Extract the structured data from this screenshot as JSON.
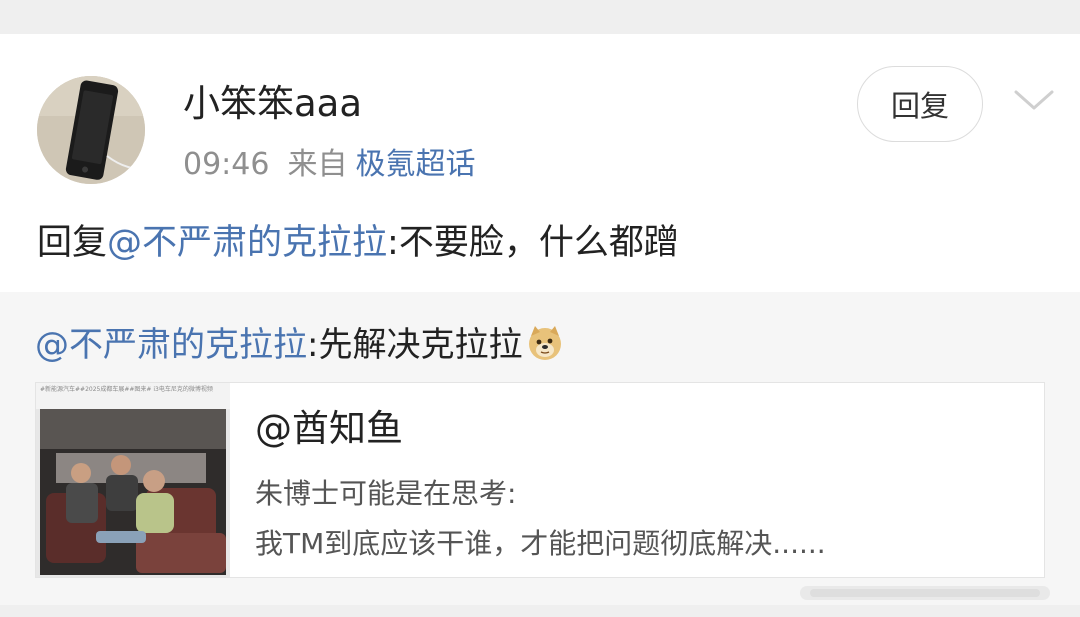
{
  "post": {
    "username": "小笨笨aaa",
    "time": "09:46",
    "source_prefix": "来自",
    "source_topic": "极氪超话",
    "reply_button": "回复",
    "comment_prefix": "回复",
    "comment_mention": "@不严肃的克拉拉",
    "comment_text": ":不要脸，什么都蹭"
  },
  "quoted": {
    "mention": "@不严肃的克拉拉",
    "text": ":先解决克拉拉",
    "emoji_icon": "doge-emoji-icon"
  },
  "card": {
    "title": "@酋知鱼",
    "line1": "朱博士可能是在思考:",
    "line2": "我TM到底应该干谁，才能把问题彻底解决......",
    "thumbnail_caption": "#新能源汽车##2025成都车展##图来# i3电车尼克的微博视频"
  },
  "colors": {
    "link": "#4a74b0",
    "meta": "#8f8f8f",
    "quote_bg": "#f6f6f6"
  },
  "icons": {
    "chevron": "chevron-down-icon"
  }
}
